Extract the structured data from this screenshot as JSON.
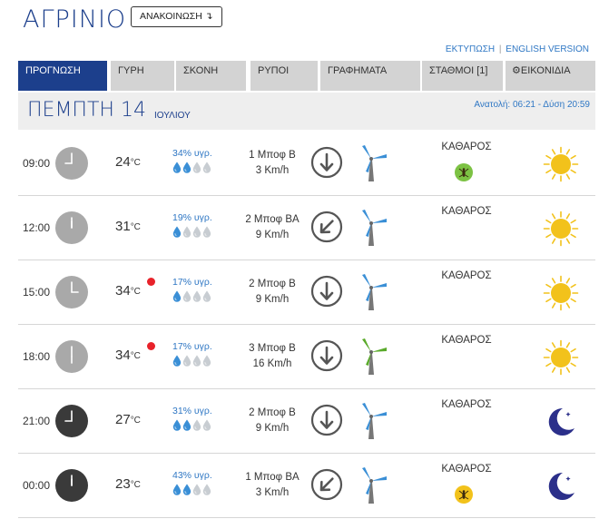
{
  "header": {
    "city": "ΑΓΡΙΝΙΟ",
    "announce_label": "ΑΝΑΚΟΙΝΩΣΗ ↴",
    "print_link": "ΕΚΤΥΠΩΣΗ",
    "separator": "|",
    "english_link": "ENGLISH VERSION"
  },
  "tabs": [
    {
      "label": "ΠΡΟΓΝΩΣΗ",
      "active": true
    },
    {
      "label": "ΓΥΡΗ",
      "active": false
    },
    {
      "label": "ΣΚΟΝΗ",
      "active": false
    },
    {
      "label": "ΡΥΠΟΙ",
      "active": false
    },
    {
      "label": "ΓΡΑΦΗΜΑΤΑ",
      "active": false
    },
    {
      "label": "ΣΤΑΘΜΟΙ [1]",
      "active": false
    },
    {
      "label": "ΕΙΚΟΝΙΔΙΑ",
      "active": false,
      "icon": "gear-icon"
    }
  ],
  "day": {
    "name": "ΠΕΜΠΤΗ 14",
    "month": "ΙΟΥΛΙΟΥ",
    "sun_times": "Ανατολή: 06:21  - Δύση 20:59"
  },
  "colors": {
    "brand": "#1c3f8c",
    "link": "#2f77c4",
    "drop_filled": "#3a8fd6",
    "drop_empty": "#c8cdd2",
    "turbine_blue": "#3a8fd6",
    "turbine_green": "#5aaa2b",
    "hot_dot": "#e8222a",
    "sun": "#f2c21b",
    "moon": "#2b2f8a"
  },
  "forecast": [
    {
      "time": "09:00",
      "hour": 9,
      "night_clock": false,
      "temp": "24",
      "unit": "°C",
      "hot": false,
      "humidity": "34% υγρ.",
      "drops": 2,
      "wind_force": "1 Μποφ Β",
      "wind_speed": "3 Km/h",
      "wind_dir": "down",
      "turbine": "blue",
      "sky": "ΚΑΘΑΡΟΣ",
      "mosquito": "green",
      "weather_icon": "sun-icon"
    },
    {
      "time": "12:00",
      "hour": 12,
      "night_clock": false,
      "temp": "31",
      "unit": "°C",
      "hot": false,
      "humidity": "19% υγρ.",
      "drops": 1,
      "wind_force": "2 Μποφ ΒΑ",
      "wind_speed": "9 Km/h",
      "wind_dir": "down-left",
      "turbine": "blue",
      "sky": "ΚΑΘΑΡΟΣ",
      "mosquito": "",
      "weather_icon": "sun-icon"
    },
    {
      "time": "15:00",
      "hour": 15,
      "night_clock": false,
      "temp": "34",
      "unit": "°C",
      "hot": true,
      "humidity": "17% υγρ.",
      "drops": 1,
      "wind_force": "2 Μποφ Β",
      "wind_speed": "9 Km/h",
      "wind_dir": "down",
      "turbine": "blue",
      "sky": "ΚΑΘΑΡΟΣ",
      "mosquito": "",
      "weather_icon": "sun-icon"
    },
    {
      "time": "18:00",
      "hour": 18,
      "night_clock": false,
      "temp": "34",
      "unit": "°C",
      "hot": true,
      "humidity": "17% υγρ.",
      "drops": 1,
      "wind_force": "3 Μποφ Β",
      "wind_speed": "16 Km/h",
      "wind_dir": "down",
      "turbine": "green",
      "sky": "ΚΑΘΑΡΟΣ",
      "mosquito": "",
      "weather_icon": "sun-icon"
    },
    {
      "time": "21:00",
      "hour": 21,
      "night_clock": true,
      "temp": "27",
      "unit": "°C",
      "hot": false,
      "humidity": "31% υγρ.",
      "drops": 2,
      "wind_force": "2 Μποφ Β",
      "wind_speed": "9 Km/h",
      "wind_dir": "down",
      "turbine": "blue",
      "sky": "ΚΑΘΑΡΟΣ",
      "mosquito": "",
      "weather_icon": "moon-icon"
    },
    {
      "time": "00:00",
      "hour": 0,
      "night_clock": true,
      "temp": "23",
      "unit": "°C",
      "hot": false,
      "humidity": "43% υγρ.",
      "drops": 2,
      "wind_force": "1 Μποφ ΒΑ",
      "wind_speed": "3 Km/h",
      "wind_dir": "down-left",
      "turbine": "blue",
      "sky": "ΚΑΘΑΡΟΣ",
      "mosquito": "yellow",
      "weather_icon": "moon-icon"
    }
  ]
}
